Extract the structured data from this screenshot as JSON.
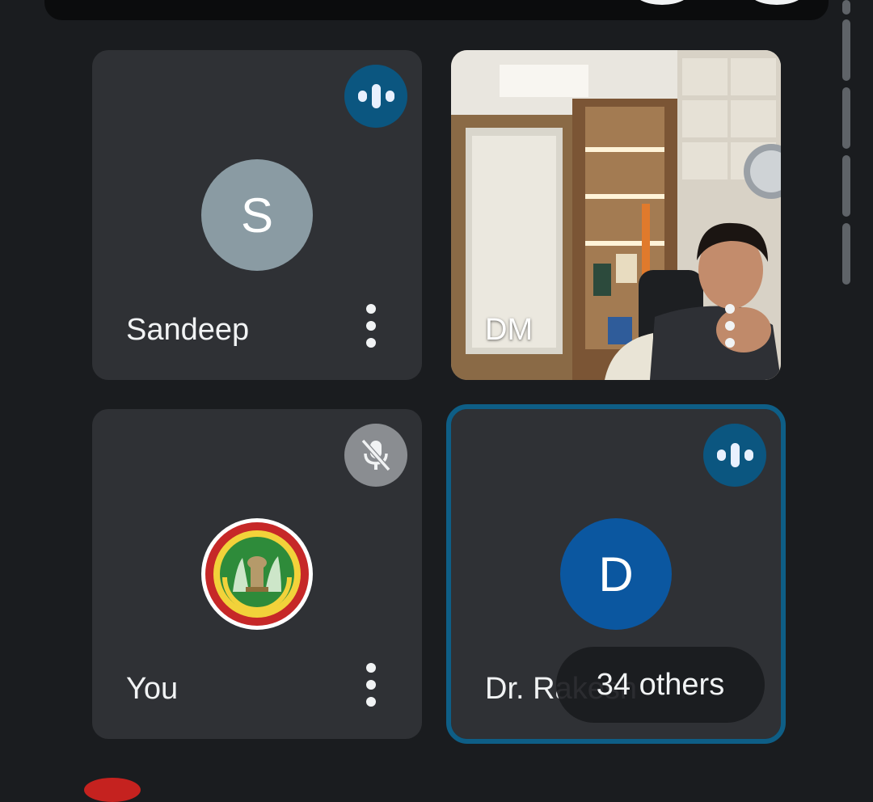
{
  "participants": [
    {
      "name": "Sandeep",
      "initial": "S",
      "avatar_color": "#8a9ba3",
      "status": "speaking"
    },
    {
      "name": "DM",
      "status": "video"
    },
    {
      "name": "You",
      "status": "muted",
      "avatar": "emblem"
    },
    {
      "name": "Dr. Rakesh",
      "initial": "D",
      "avatar_color": "#0b57a0",
      "status": "speaking"
    }
  ],
  "others_chip": "34 others",
  "colors": {
    "tile_bg": "#2f3135",
    "page_bg": "#1a1c1f",
    "active_border": "#0e5e86",
    "speaking_badge": "#0b5680"
  },
  "icons": [
    "speaking-indicator-icon",
    "mic-off-icon",
    "more-vert-icon"
  ]
}
